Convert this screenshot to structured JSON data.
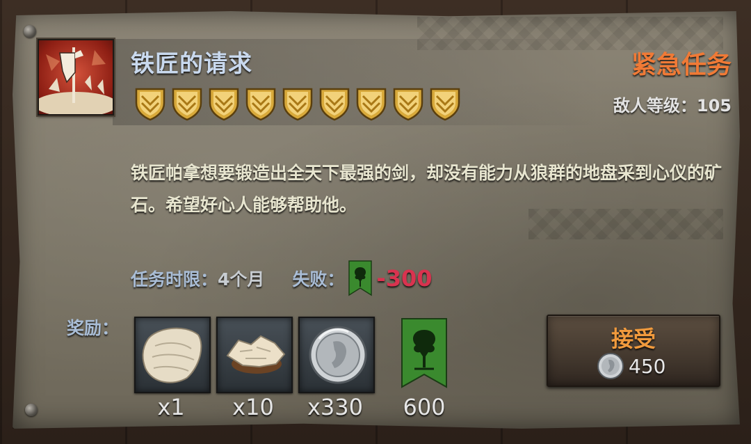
{
  "quest": {
    "title": "铁匠的请求",
    "urgency": "紧急任务",
    "enemy_level_text": "敌人等级：105",
    "difficulty_shields": 9,
    "description": "铁匠帕拿想要锻造出全天下最强的剑，却没有能力从狼群的地盘采到心仪的矿石。希望好心人能够帮助他。",
    "deadline_label": "任务时限：",
    "deadline_value": "4个月",
    "fail_label": "失败：",
    "fail_penalty": "-300",
    "icon": "quest-banner-icon"
  },
  "rewards": {
    "label": "奖励：",
    "items": [
      {
        "icon": "hide-pelt-icon",
        "quantity": "x1"
      },
      {
        "icon": "hide-scraps-icon",
        "quantity": "x10"
      },
      {
        "icon": "silver-coin-icon",
        "quantity": "x330"
      },
      {
        "icon": "faction-banner-icon",
        "quantity": "600"
      }
    ]
  },
  "accept_button": {
    "label": "接受",
    "cost": "450",
    "cost_icon": "silver-coin-icon"
  },
  "colors": {
    "title": "#c9d9ee",
    "urgent": "#f07a36",
    "penalty": "#d9334f",
    "accept_label": "#f09a3d",
    "banner_green": "#3a8a2e"
  }
}
